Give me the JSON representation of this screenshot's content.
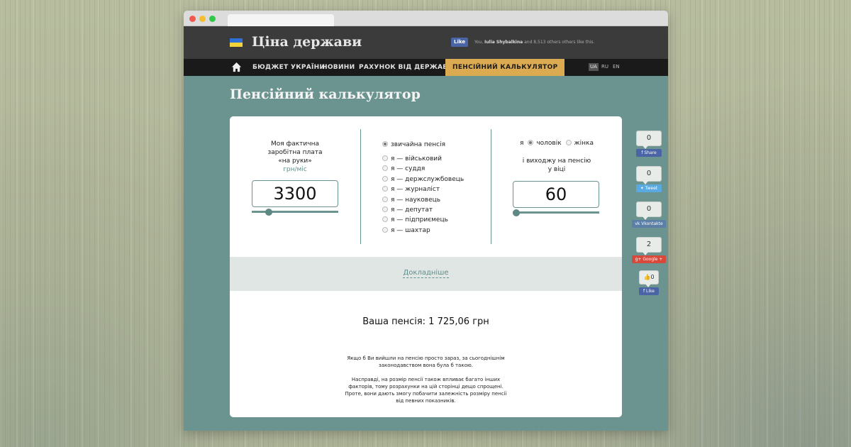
{
  "site": {
    "title": "Ціна держави"
  },
  "facebook": {
    "like_label": "Like",
    "like_text_user": "Iulia Shybalkina",
    "like_text_prefix": "You, ",
    "like_text_suffix": " and 8,513 others others like this."
  },
  "nav": {
    "items": [
      {
        "label": "БЮДЖЕТ УКРАЇНИ"
      },
      {
        "label": "НОВИНИ"
      },
      {
        "label": "РАХУНОК ВІД ДЕРЖАВИ"
      },
      {
        "label": "ПЕНСІЙНИЙ КАЛЬКУЛЯТОР",
        "active": true
      }
    ],
    "languages": [
      {
        "code": "UA",
        "active": true
      },
      {
        "code": "RU",
        "active": false
      },
      {
        "code": "EN",
        "active": false
      }
    ]
  },
  "page": {
    "title": "Пенсійний калькулятор"
  },
  "income": {
    "label_line1": "Моя фактична",
    "label_line2": "заробітна плата",
    "label_line3": "«на руки»",
    "unit": "грн/міс",
    "value": "3300",
    "slider_fraction": 0.17
  },
  "categories": {
    "selected": 0,
    "options": [
      "звичайна пенсія",
      "я — військовий",
      "я — суддя",
      "я — держслужбовець",
      "я — журналіст",
      "я — науковець",
      "я — депутат",
      "я — підприємець",
      "я — шахтар"
    ]
  },
  "retirement": {
    "prefix": "я",
    "male": "чоловік",
    "female": "жінка",
    "selected": "male",
    "label_line1": "і виходжу на пенсію",
    "label_line2": "у віці",
    "age": "60",
    "slider_fraction": 0.0
  },
  "details_link": "Докладніше",
  "result": {
    "text": "Ваша пенсія: 1 725,06 грн"
  },
  "notes": {
    "p1_line1": "Якщо б Ви вийшли на пенсію просто зараз, за сьогоднішнім",
    "p1_line2": "законодавством вона була б такою.",
    "p2_line1": "Насправді, на розмір пенсії також впливає багато інших",
    "p2_line2": "факторів, тому розрахунки на цій сторінці дещо спрощені.",
    "p2_line3": "Проте, вони дають змогу побачити залежність розміру пенсії",
    "p2_line4": "від певних показників."
  },
  "share": [
    {
      "network": "facebook",
      "count": "0",
      "label": "Share",
      "color": "#4a64a5"
    },
    {
      "network": "twitter",
      "count": "0",
      "label": "Tweet",
      "color": "#5aa9e0"
    },
    {
      "network": "vkontakte",
      "count": "0",
      "label": "Vkontakte",
      "color": "#5b7fa6"
    },
    {
      "network": "google",
      "count": "2",
      "label": "Google +",
      "color": "#d6493b"
    }
  ],
  "fb_like": {
    "count": "0",
    "label": "Like"
  },
  "colors": {
    "accent": "#6b9490",
    "nav_active": "#dcaa50",
    "topbar": "#3b3b3b",
    "navbar": "#1a1a1a"
  }
}
